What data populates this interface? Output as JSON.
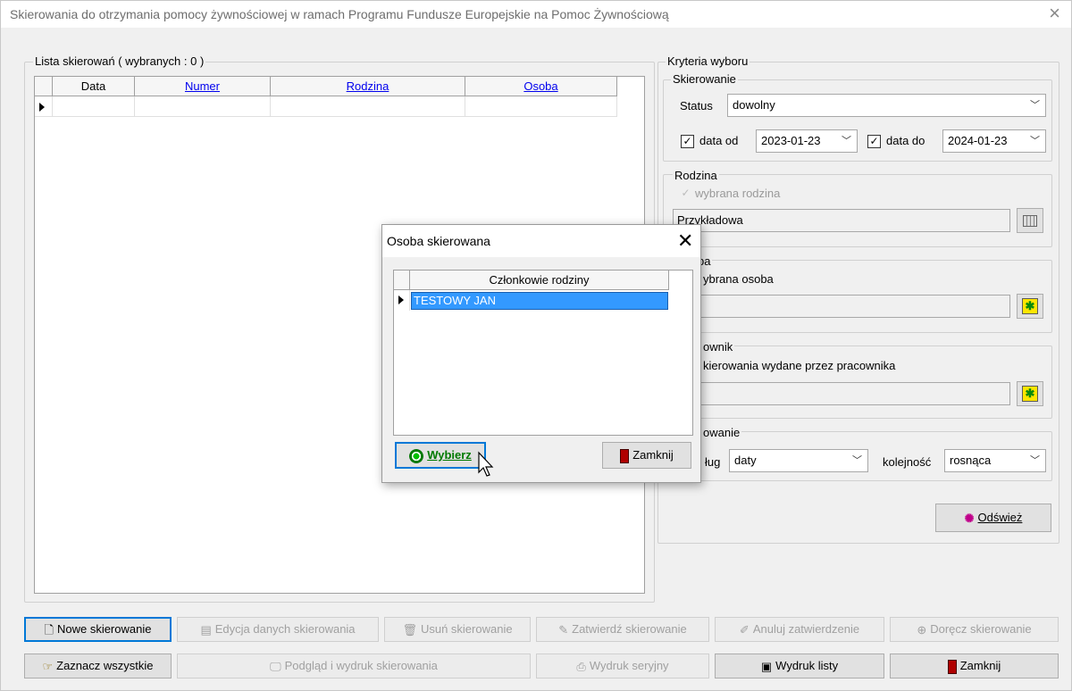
{
  "window": {
    "title": "Skierowania do otrzymania pomocy żywnościowej w ramach Programu Fundusze Europejskie na Pomoc Żywnościową",
    "close": "×"
  },
  "list": {
    "label": "Lista skierowań ( wybranych : 0 )",
    "columns": [
      "Data",
      "Numer",
      "Rodzina",
      "Osoba"
    ]
  },
  "criteria": {
    "label": "Kryteria wyboru",
    "skierowanie": {
      "label": "Skierowanie",
      "status_label": "Status",
      "status_value": "dowolny",
      "date_from_label": "data od",
      "date_from_value": "2023-01-23",
      "date_to_label": "data do",
      "date_to_value": "2024-01-23"
    },
    "rodzina": {
      "label": "Rodzina",
      "checkbox_label": "wybrana rodzina",
      "value": "Przykładowa"
    },
    "osoba": {
      "label": "ba",
      "checkbox_label": "ybrana osoba"
    },
    "pracownik": {
      "label": "ownik",
      "checkbox_label": "kierowania wydane przez pracownika"
    },
    "sortowanie": {
      "label": "owanie",
      "by_label": "ług",
      "by_value": "daty",
      "order_label": "kolejność",
      "order_value": "rosnąca"
    },
    "refresh_button": "Odśwież"
  },
  "toolbar": {
    "row1": {
      "nowe": "Nowe skierowanie",
      "edycja": "Edycja danych skierowania",
      "usun": "Usuń skierowanie",
      "zatwierdz": "Zatwierdź skierowanie",
      "anuluj": "Anuluj zatwierdzenie",
      "dorecz": "Doręcz skierowanie"
    },
    "row2": {
      "zaznacz": "Zaznacz wszystkie",
      "podglad": "Podgląd i wydruk skierowania",
      "seryjny": "Wydruk seryjny",
      "listy": "Wydruk listy",
      "zamknij": "Zamknij"
    }
  },
  "dialog": {
    "title": "Osoba skierowana",
    "close": "✕",
    "column": "Członkowie rodziny",
    "rows": [
      "TESTOWY JAN"
    ],
    "select_button": "Wybierz",
    "close_button": "Zamknij"
  },
  "colors": {
    "selection": "#3399ff",
    "link": "#0000ee",
    "focus": "#0078d7",
    "green": "#007a00"
  }
}
